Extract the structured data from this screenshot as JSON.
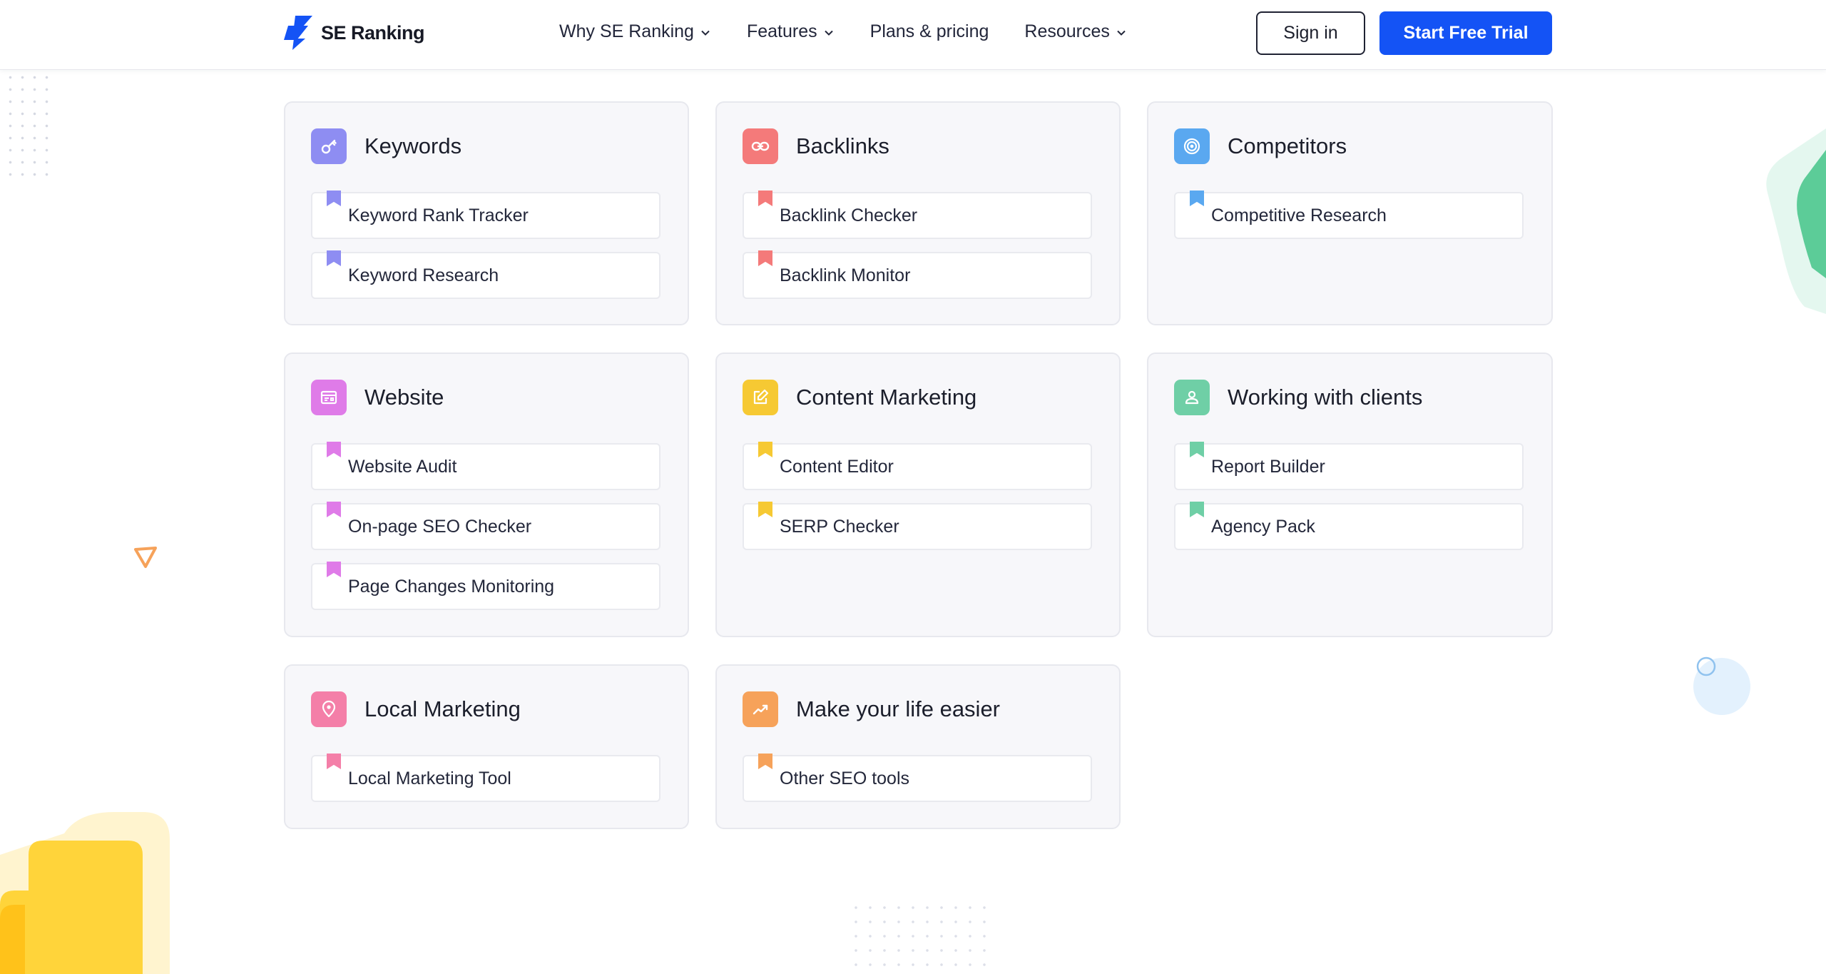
{
  "header": {
    "logo_text": "SE Ranking",
    "nav": [
      {
        "label": "Why SE Ranking",
        "dropdown": true
      },
      {
        "label": "Features",
        "dropdown": true
      },
      {
        "label": "Plans & pricing",
        "dropdown": false
      },
      {
        "label": "Resources",
        "dropdown": true
      }
    ],
    "sign_in_label": "Sign in",
    "trial_label": "Start Free Trial"
  },
  "colors": {
    "brand_blue": "#1453f5",
    "keywords": "#8e8df2",
    "backlinks": "#f47a7a",
    "competitors": "#5aa8f0",
    "website": "#df7be8",
    "content": "#f6c933",
    "clients": "#6fcfa6",
    "local": "#f47fa8",
    "easier": "#f6a25a"
  },
  "categories": [
    {
      "title": "Keywords",
      "icon": "key-icon",
      "items": [
        "Keyword Rank Tracker",
        "Keyword Research"
      ]
    },
    {
      "title": "Backlinks",
      "icon": "link-icon",
      "items": [
        "Backlink Checker",
        "Backlink Monitor"
      ]
    },
    {
      "title": "Competitors",
      "icon": "target-icon",
      "items": [
        "Competitive Research"
      ]
    },
    {
      "title": "Website",
      "icon": "browser-icon",
      "items": [
        "Website Audit",
        "On-page SEO Checker",
        "Page Changes Monitoring"
      ]
    },
    {
      "title": "Content Marketing",
      "icon": "edit-icon",
      "items": [
        "Content Editor",
        "SERP Checker"
      ]
    },
    {
      "title": "Working with clients",
      "icon": "user-icon",
      "items": [
        "Report Builder",
        "Agency Pack"
      ]
    },
    {
      "title": "Local Marketing",
      "icon": "map-pin-icon",
      "items": [
        "Local Marketing Tool"
      ]
    },
    {
      "title": "Make your life easier",
      "icon": "trend-up-icon",
      "items": [
        "Other SEO tools"
      ]
    }
  ]
}
